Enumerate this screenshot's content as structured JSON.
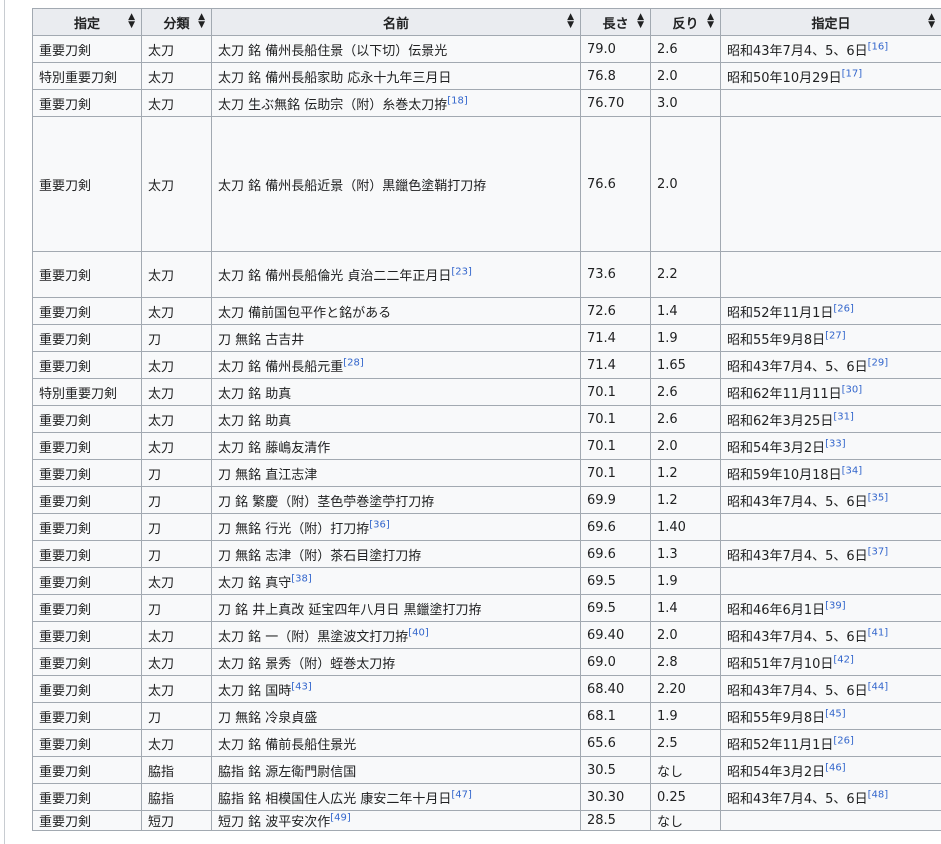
{
  "table": {
    "headers": [
      "指定",
      "分類",
      "名前",
      "長さ",
      "反り",
      "指定日"
    ],
    "rows": [
      {
        "designation": "重要刀剣",
        "category": "太刀",
        "name": "太刀 銘 備州長船住景（以下切）伝景光",
        "length": "79.0",
        "curve": "2.6",
        "date": "昭和43年7月4、5、6日",
        "ref": "[16]"
      },
      {
        "designation": "特別重要刀剣",
        "category": "太刀",
        "name": "太刀 銘 備州長船家助 応永十九年三月日",
        "length": "76.8",
        "curve": "2.0",
        "date": "昭和50年10月29日",
        "ref": "[17]"
      },
      {
        "designation": "重要刀剣",
        "category": "太刀",
        "name": "太刀 生ぶ無銘 伝助宗（附）糸巻太刀拵",
        "name_ref": "[18]",
        "length": "76.70",
        "curve": "3.0",
        "date": "",
        "ref": ""
      },
      {
        "designation": "重要刀剣",
        "category": "太刀",
        "name": "太刀 銘 備州長船近景（附）黒鑞色塗鞘打刀拵",
        "length": "76.6",
        "curve": "2.0",
        "date": "",
        "ref": ""
      },
      {
        "designation": "重要刀剣",
        "category": "太刀",
        "name": "太刀 銘 備州長船倫光 貞治二二年正月日",
        "name_ref": "[23]",
        "length": "73.6",
        "curve": "2.2",
        "date": "",
        "ref": ""
      },
      {
        "designation": "重要刀剣",
        "category": "太刀",
        "name": "太刀 備前国包平作と銘がある",
        "length": "72.6",
        "curve": "1.4",
        "date": "昭和52年11月1日",
        "ref": "[26]"
      },
      {
        "designation": "重要刀剣",
        "category": "刀",
        "name": "刀 無銘 古吉井",
        "length": "71.4",
        "curve": "1.9",
        "date": "昭和55年9月8日",
        "ref": "[27]"
      },
      {
        "designation": "重要刀剣",
        "category": "太刀",
        "name": "太刀 銘 備州長船元重",
        "name_ref": "[28]",
        "length": "71.4",
        "curve": "1.65",
        "date": "昭和43年7月4、5、6日",
        "ref": "[29]"
      },
      {
        "designation": "特別重要刀剣",
        "category": "太刀",
        "name": "太刀 銘 助真",
        "length": "70.1",
        "curve": "2.6",
        "date": "昭和62年11月11日",
        "ref": "[30]"
      },
      {
        "designation": "重要刀剣",
        "category": "太刀",
        "name": "太刀 銘 助真",
        "length": "70.1",
        "curve": "2.6",
        "date": "昭和62年3月25日",
        "ref": "[31]"
      },
      {
        "designation": "重要刀剣",
        "category": "太刀",
        "name": "太刀 銘 藤嶋友清作",
        "length": "70.1",
        "curve": "2.0",
        "date": "昭和54年3月2日",
        "ref": "[33]"
      },
      {
        "designation": "重要刀剣",
        "category": "刀",
        "name": "刀 無銘 直江志津",
        "length": "70.1",
        "curve": "1.2",
        "date": "昭和59年10月18日",
        "ref": "[34]"
      },
      {
        "designation": "重要刀剣",
        "category": "刀",
        "name": "刀 銘 繁慶（附）茎色苧巻塗苧打刀拵",
        "length": "69.9",
        "curve": "1.2",
        "date": "昭和43年7月4、5、6日",
        "ref": "[35]"
      },
      {
        "designation": "重要刀剣",
        "category": "刀",
        "name": "刀 無銘 行光（附）打刀拵",
        "name_ref": "[36]",
        "length": "69.6",
        "curve": "1.40",
        "date": "",
        "ref": ""
      },
      {
        "designation": "重要刀剣",
        "category": "刀",
        "name": "刀 無銘 志津（附）茶石目塗打刀拵",
        "length": "69.6",
        "curve": "1.3",
        "date": "昭和43年7月4、5、6日",
        "ref": "[37]"
      },
      {
        "designation": "重要刀剣",
        "category": "太刀",
        "name": "太刀 銘 真守",
        "name_ref": "[38]",
        "length": "69.5",
        "curve": "1.9",
        "date": "",
        "ref": ""
      },
      {
        "designation": "重要刀剣",
        "category": "刀",
        "name": "刀 銘 井上真改 延宝四年八月日 黒鑞塗打刀拵",
        "length": "69.5",
        "curve": "1.4",
        "date": "昭和46年6月1日",
        "ref": "[39]"
      },
      {
        "designation": "重要刀剣",
        "category": "太刀",
        "name": "太刀 銘 一（附）黒塗波文打刀拵",
        "name_ref": "[40]",
        "length": "69.40",
        "curve": "2.0",
        "date": "昭和43年7月4、5、6日",
        "ref": "[41]"
      },
      {
        "designation": "重要刀剣",
        "category": "太刀",
        "name": "太刀 銘 景秀（附）蛭巻太刀拵",
        "length": "69.0",
        "curve": "2.8",
        "date": "昭和51年7月10日",
        "ref": "[42]"
      },
      {
        "designation": "重要刀剣",
        "category": "太刀",
        "name": "太刀 銘 国時",
        "name_ref": "[43]",
        "length": "68.40",
        "curve": "2.20",
        "date": "昭和43年7月4、5、6日",
        "ref": "[44]"
      },
      {
        "designation": "重要刀剣",
        "category": "刀",
        "name": "刀 無銘 冷泉貞盛",
        "length": "68.1",
        "curve": "1.9",
        "date": "昭和55年9月8日",
        "ref": "[45]"
      },
      {
        "designation": "重要刀剣",
        "category": "太刀",
        "name": "太刀 銘 備前長船住景光",
        "length": "65.6",
        "curve": "2.5",
        "date": "昭和52年11月1日",
        "ref": "[26]"
      },
      {
        "designation": "重要刀剣",
        "category": "脇指",
        "name": "脇指 銘 源左衛門尉信国",
        "length": "30.5",
        "curve": "なし",
        "date": "昭和54年3月2日",
        "ref": "[46]"
      },
      {
        "designation": "重要刀剣",
        "category": "脇指",
        "name": "脇指 銘 相模国住人広光 康安二年十月日",
        "name_ref": "[47]",
        "length": "30.30",
        "curve": "0.25",
        "date": "昭和43年7月4、5、6日",
        "ref": "[48]"
      },
      {
        "designation": "重要刀剣",
        "category": "短刀",
        "name": "短刀 銘 波平安次作",
        "name_ref": "[49]",
        "length": "28.5",
        "curve": "なし",
        "date": "",
        "ref": ""
      }
    ]
  },
  "colors": {
    "header_bg": "#eaecf0",
    "cell_bg": "#f8f9fa",
    "border": "#a2a9b1",
    "link": "#3366cc"
  }
}
